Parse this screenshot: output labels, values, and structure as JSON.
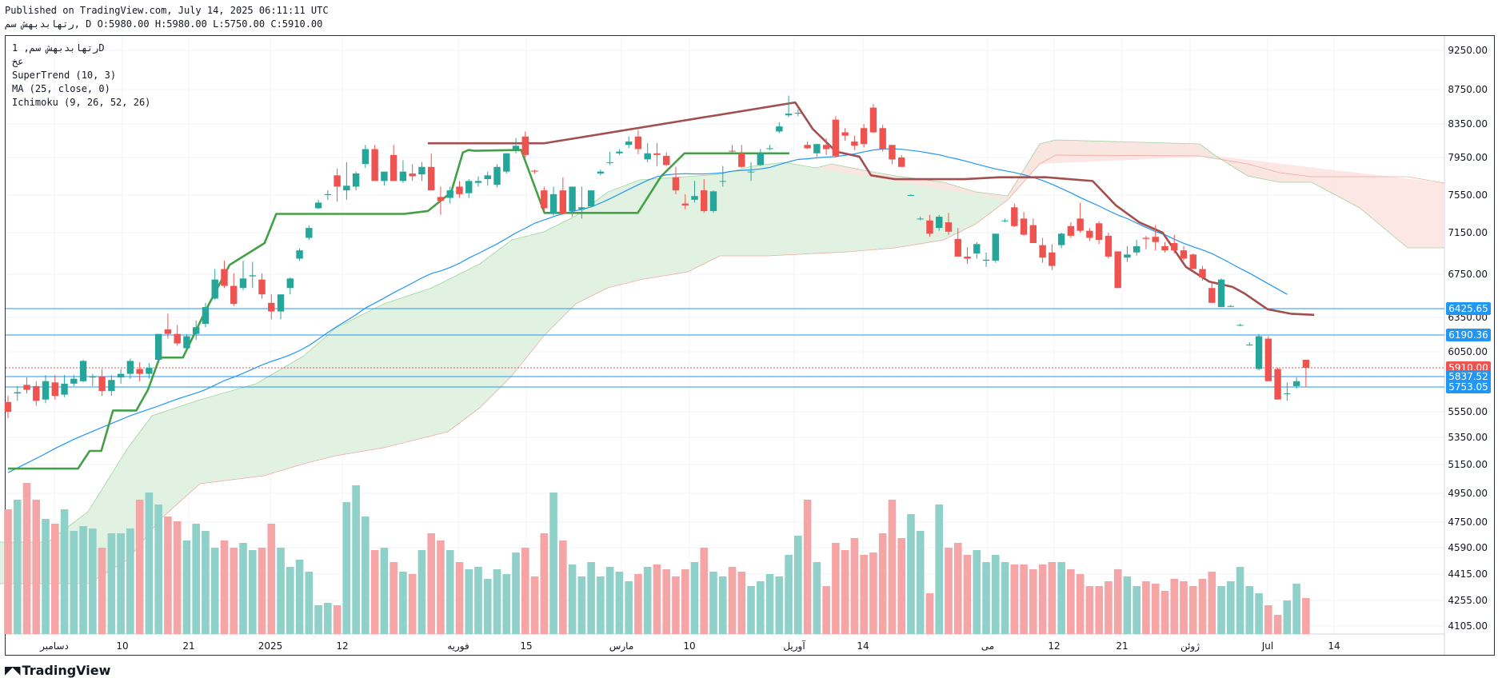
{
  "header": {
    "published": "Published on TradingView.com, July 14, 2025 06:11:11 UTC",
    "ohlc": "رتهابدبهش سم, D O:5980.00 H:5980.00 L:5750.00 C:5910.00"
  },
  "legend": {
    "symbol": "رتهابدبهش سم, 1D",
    "exchange": "عخ",
    "supertrend": "SuperTrend (10, 3)",
    "ma": "MA (25, close, 0)",
    "ichimoku": "Ichimoku (9, 26, 52, 26)"
  },
  "brand": {
    "name": "TradingView",
    "icon": "tradingview-logo-icon"
  },
  "colors": {
    "up": "#26a69a",
    "down": "#ef5350",
    "vol_up": "#8fd0c9",
    "vol_down": "#f5a5a5",
    "ma": "#2196f3",
    "st_up": "#43a047",
    "st_down": "#a14f4f",
    "cloud_green": "#e2f2e2",
    "cloud_red": "#fde4e1",
    "hline": "#2196f3"
  },
  "chart_data": {
    "type": "candlestick",
    "y_axis": {
      "ticks": [
        "9250.00",
        "8750.00",
        "8350.00",
        "7950.00",
        "7550.00",
        "7150.00",
        "6750.00",
        "6350.00",
        "6050.00",
        "5550.00",
        "5350.00",
        "5150.00",
        "4950.00",
        "4750.00",
        "4590.00",
        "4415.00",
        "4255.00",
        "4105.00"
      ]
    },
    "x_axis": {
      "labels": [
        "دسامبر",
        "10",
        "21",
        "2025",
        "12",
        "فوریه",
        "15",
        "مارس",
        "10",
        "آوریل",
        "14",
        "می",
        "12",
        "21",
        "ژوئن",
        "Jul",
        "14"
      ]
    },
    "price_lines": [
      {
        "label": "6425.65",
        "value": 6425.65,
        "style": "solid"
      },
      {
        "label": "6190.36",
        "value": 6190.36,
        "style": "solid"
      },
      {
        "label": "5910.00",
        "value": 5910.0,
        "style": "dotted",
        "current": true
      },
      {
        "label": "5837.52",
        "value": 5837.52,
        "style": "solid"
      },
      {
        "label": "5753.05",
        "value": 5753.05,
        "style": "solid"
      }
    ],
    "candles": [
      [
        5630,
        5680,
        5500,
        5550
      ],
      [
        5700,
        5760,
        5640,
        5710
      ],
      [
        5770,
        5830,
        5700,
        5730
      ],
      [
        5760,
        5800,
        5600,
        5640
      ],
      [
        5650,
        5850,
        5620,
        5800
      ],
      [
        5790,
        5850,
        5650,
        5680
      ],
      [
        5690,
        5850,
        5670,
        5780
      ],
      [
        5780,
        5850,
        5760,
        5820
      ],
      [
        5800,
        5980,
        5790,
        5970
      ],
      [
        5830,
        5860,
        5760,
        5840
      ],
      [
        5840,
        5900,
        5680,
        5720
      ],
      [
        5720,
        5850,
        5680,
        5810
      ],
      [
        5830,
        5900,
        5780,
        5860
      ],
      [
        5860,
        5990,
        5820,
        5970
      ],
      [
        5900,
        5960,
        5800,
        5860
      ],
      [
        5860,
        5950,
        5820,
        5910
      ],
      [
        5980,
        6200,
        5960,
        6200
      ],
      [
        6240,
        6380,
        6160,
        6200
      ],
      [
        6200,
        6280,
        6100,
        6120
      ],
      [
        6080,
        6200,
        6060,
        6180
      ],
      [
        6200,
        6320,
        6150,
        6260
      ],
      [
        6290,
        6480,
        6260,
        6440
      ],
      [
        6520,
        6800,
        6510,
        6700
      ],
      [
        6800,
        6880,
        6620,
        6640
      ],
      [
        6640,
        6760,
        6450,
        6470
      ],
      [
        6620,
        6880,
        6600,
        6710
      ],
      [
        6730,
        6870,
        6620,
        6740
      ],
      [
        6700,
        6760,
        6520,
        6560
      ],
      [
        6480,
        6560,
        6330,
        6400
      ],
      [
        6400,
        6560,
        6330,
        6560
      ],
      [
        6620,
        6720,
        6560,
        6710
      ],
      [
        6900,
        7000,
        6880,
        6980
      ],
      [
        7100,
        7230,
        7080,
        7200
      ],
      [
        7410,
        7500,
        7400,
        7470
      ],
      [
        7550,
        7600,
        7500,
        7560
      ],
      [
        7760,
        7830,
        7480,
        7640
      ],
      [
        7600,
        7900,
        7500,
        7650
      ],
      [
        7640,
        7800,
        7600,
        7780
      ],
      [
        7880,
        8100,
        7840,
        8050
      ],
      [
        8050,
        8100,
        7720,
        7700
      ],
      [
        7700,
        7800,
        7650,
        7800
      ],
      [
        7980,
        8100,
        7700,
        7700
      ],
      [
        7700,
        7920,
        7680,
        7800
      ],
      [
        7780,
        7880,
        7700,
        7750
      ],
      [
        7770,
        7900,
        7700,
        7850
      ],
      [
        7850,
        8000,
        7600,
        7600
      ],
      [
        7530,
        7640,
        7340,
        7490
      ],
      [
        7520,
        7640,
        7460,
        7600
      ],
      [
        7640,
        7700,
        7520,
        7560
      ],
      [
        7570,
        7720,
        7520,
        7700
      ],
      [
        7680,
        7750,
        7640,
        7700
      ],
      [
        7720,
        7800,
        7650,
        7760
      ],
      [
        7660,
        7880,
        7630,
        7850
      ],
      [
        7800,
        8000,
        7780,
        8000
      ],
      [
        8050,
        8180,
        8000,
        8090
      ],
      [
        8200,
        8260,
        7950,
        7980
      ],
      [
        7810,
        7820,
        7780,
        7800
      ],
      [
        7600,
        7640,
        7380,
        7410
      ],
      [
        7350,
        7640,
        7330,
        7560
      ],
      [
        7600,
        7740,
        7340,
        7350
      ],
      [
        7380,
        7640,
        7320,
        7640
      ],
      [
        7400,
        7640,
        7300,
        7420
      ],
      [
        7430,
        7600,
        7420,
        7600
      ],
      [
        7780,
        7820,
        7760,
        7800
      ],
      [
        7900,
        8020,
        7870,
        7900
      ],
      [
        8000,
        8050,
        7980,
        8020
      ],
      [
        8100,
        8200,
        8060,
        8140
      ],
      [
        8200,
        8280,
        7990,
        8050
      ],
      [
        7930,
        8120,
        7900,
        8000
      ],
      [
        8000,
        8120,
        7860,
        7980
      ],
      [
        7970,
        8010,
        7860,
        7870
      ],
      [
        7740,
        7850,
        7560,
        7600
      ],
      [
        7460,
        7560,
        7400,
        7440
      ],
      [
        7500,
        7700,
        7470,
        7540
      ],
      [
        7600,
        7720,
        7360,
        7380
      ],
      [
        7380,
        7600,
        7360,
        7590
      ],
      [
        7700,
        7860,
        7640,
        7700
      ],
      [
        8030,
        8100,
        7990,
        8020
      ],
      [
        8000,
        8100,
        7840,
        7850
      ],
      [
        7800,
        7900,
        7700,
        7800
      ],
      [
        7870,
        8050,
        7860,
        8000
      ],
      [
        8050,
        8100,
        8040,
        8060
      ],
      [
        8260,
        8370,
        8240,
        8320
      ],
      [
        8450,
        8680,
        8430,
        8470
      ],
      [
        8470,
        8520,
        8440,
        8480
      ],
      [
        8100,
        8140,
        8050,
        8060
      ],
      [
        8000,
        8110,
        7960,
        8110
      ],
      [
        8100,
        8180,
        7980,
        8050
      ],
      [
        8400,
        8440,
        7950,
        7970
      ],
      [
        8250,
        8300,
        8150,
        8210
      ],
      [
        8140,
        8210,
        8040,
        8090
      ],
      [
        8300,
        8350,
        8070,
        8110
      ],
      [
        8540,
        8580,
        8240,
        8250
      ],
      [
        8300,
        8340,
        8020,
        8050
      ],
      [
        8100,
        8100,
        7880,
        7930
      ],
      [
        7950,
        7980,
        7850,
        7850
      ],
      [
        7550,
        7560,
        7540,
        7550
      ],
      [
        7300,
        7320,
        7280,
        7300
      ],
      [
        7280,
        7340,
        7110,
        7140
      ],
      [
        7200,
        7340,
        7170,
        7320
      ],
      [
        7260,
        7360,
        7130,
        7160
      ],
      [
        7090,
        7200,
        6920,
        6920
      ],
      [
        6920,
        7010,
        6850,
        6900
      ],
      [
        6950,
        7060,
        6900,
        7040
      ],
      [
        6880,
        6960,
        6820,
        6890
      ],
      [
        6880,
        7140,
        6860,
        7140
      ],
      [
        7280,
        7300,
        7260,
        7280
      ],
      [
        7420,
        7460,
        7210,
        7220
      ],
      [
        7300,
        7370,
        7120,
        7130
      ],
      [
        7230,
        7300,
        7050,
        7050
      ],
      [
        7030,
        7100,
        6860,
        6910
      ],
      [
        6960,
        7040,
        6790,
        6830
      ],
      [
        7030,
        7150,
        7000,
        7140
      ],
      [
        7220,
        7260,
        7100,
        7120
      ],
      [
        7300,
        7470,
        7150,
        7170
      ],
      [
        7170,
        7200,
        7070,
        7100
      ],
      [
        7250,
        7270,
        7040,
        7080
      ],
      [
        7120,
        7150,
        6900,
        6920
      ],
      [
        6970,
        6970,
        6620,
        6620
      ],
      [
        6910,
        7020,
        6870,
        6940
      ],
      [
        6960,
        7080,
        6930,
        7020
      ],
      [
        7100,
        7120,
        6990,
        7090
      ],
      [
        7110,
        7230,
        6980,
        7060
      ],
      [
        7020,
        7060,
        6960,
        6980
      ],
      [
        7050,
        7130,
        6950,
        6980
      ],
      [
        6980,
        7020,
        6880,
        6900
      ],
      [
        6940,
        6950,
        6800,
        6800
      ],
      [
        6800,
        6830,
        6690,
        6720
      ],
      [
        6620,
        6670,
        6480,
        6480
      ],
      [
        6440,
        6710,
        6440,
        6700
      ],
      [
        6450,
        6460,
        6440,
        6450
      ],
      [
        6280,
        6290,
        6270,
        6280
      ],
      [
        6110,
        6130,
        6100,
        6110
      ],
      [
        5900,
        6200,
        5890,
        6180
      ],
      [
        6160,
        6180,
        5810,
        5800
      ],
      [
        5900,
        5910,
        5720,
        5650
      ],
      [
        5700,
        5790,
        5640,
        5700
      ],
      [
        5760,
        5830,
        5740,
        5800
      ],
      [
        5980,
        5980,
        5750,
        5910
      ]
    ],
    "volume": [
      52,
      56,
      63,
      56,
      48,
      46,
      52,
      43,
      45,
      44,
      36,
      42,
      42,
      44,
      56,
      59,
      54,
      49,
      47,
      39,
      46,
      43,
      36,
      39,
      36,
      38,
      35,
      36,
      46,
      36,
      28,
      31,
      26,
      12,
      13,
      12,
      55,
      62,
      49,
      35,
      36,
      30,
      26,
      25,
      35,
      42,
      39,
      35,
      30,
      27,
      28,
      23,
      27,
      25,
      34,
      36,
      24,
      42,
      59,
      39,
      29,
      24,
      30,
      24,
      28,
      26,
      22,
      25,
      28,
      29,
      27,
      24,
      27,
      30,
      36,
      26,
      24,
      28,
      26,
      20,
      22,
      25,
      24,
      33,
      41,
      56,
      30,
      20,
      38,
      35,
      40,
      33,
      34,
      42,
      56,
      40,
      50,
      43,
      17,
      54,
      36,
      38,
      33,
      35,
      30,
      33,
      30,
      29,
      29,
      27,
      29,
      30,
      30,
      27,
      25,
      20,
      20,
      22,
      27,
      24,
      20,
      22,
      21,
      18,
      23,
      22,
      20,
      23,
      26,
      20,
      22,
      28,
      20,
      17,
      12,
      8,
      14,
      21,
      15,
      50,
      40,
      25,
      28
    ],
    "ma": [
      5090,
      5125,
      5160,
      5195,
      5230,
      5268,
      5302,
      5335,
      5366,
      5397,
      5428,
      5458,
      5489,
      5519,
      5545,
      5571,
      5597,
      5626,
      5654,
      5679,
      5703,
      5731,
      5768,
      5805,
      5833,
      5864,
      5899,
      5935,
      5966,
      5993,
      6023,
      6060,
      6103,
      6156,
      6213,
      6268,
      6319,
      6371,
      6431,
      6478,
      6525,
      6576,
      6621,
      6667,
      6715,
      6756,
      6782,
      6815,
      6856,
      6906,
      6950,
      6996,
      7042,
      7094,
      7148,
      7197,
      7251,
      7286,
      7321,
      7352,
      7376,
      7398,
      7423,
      7465,
      7511,
      7560,
      7611,
      7659,
      7707,
      7746,
      7765,
      7774,
      7778,
      7775,
      7775,
      7780,
      7787,
      7805,
      7813,
      7818,
      7828,
      7844,
      7875,
      7904,
      7930,
      7936,
      7947,
      7955,
      7961,
      7977,
      7993,
      8017,
      8039,
      8051,
      8054,
      8048,
      8035,
      8021,
      8001,
      7983,
      7954,
      7932,
      7907,
      7879,
      7854,
      7828,
      7809,
      7790,
      7767,
      7738,
      7705,
      7665,
      7621,
      7574,
      7524,
      7478,
      7434,
      7384,
      7338,
      7300,
      7252,
      7206,
      7161,
      7130,
      7087,
      7048,
      7015,
      6984,
      6949,
      6903,
      6855,
      6806,
      6760,
      6710,
      6660,
      6610,
      6560
    ],
    "supertrend": [
      {
        "trend": "up",
        "points": [
          [
            0,
            5120
          ],
          [
            12,
            5120
          ],
          [
            14,
            5250
          ],
          [
            16,
            5250
          ],
          [
            18,
            5560
          ],
          [
            22,
            5560
          ],
          [
            24,
            5730
          ],
          [
            26,
            6000
          ],
          [
            30,
            6000
          ],
          [
            34,
            6420
          ],
          [
            38,
            6840
          ],
          [
            42,
            6980
          ],
          [
            44,
            7050
          ],
          [
            46,
            7350
          ],
          [
            66,
            7350
          ],
          [
            68,
            7350
          ],
          [
            72,
            7380
          ],
          [
            76,
            7580
          ],
          [
            78,
            8010
          ],
          [
            79,
            8040
          ],
          [
            80,
            8030
          ],
          [
            88,
            8040
          ],
          [
            92,
            7360
          ],
          [
            104,
            7360
          ],
          [
            108,
            7360
          ],
          [
            112,
            7750
          ],
          [
            116,
            8000
          ],
          [
            130,
            8000
          ],
          [
            134,
            8000
          ]
        ]
      },
      {
        "trend": "down",
        "points": [
          [
            72,
            8120
          ],
          [
            80,
            8120
          ],
          [
            86,
            8120
          ],
          [
            90,
            8120
          ],
          [
            92,
            8120
          ],
          [
            135,
            8600
          ],
          [
            138,
            8290
          ],
          [
            142,
            8020
          ],
          [
            146,
            7960
          ],
          [
            148,
            7760
          ],
          [
            152,
            7720
          ],
          [
            164,
            7720
          ],
          [
            170,
            7740
          ],
          [
            178,
            7740
          ],
          [
            182,
            7720
          ],
          [
            186,
            7700
          ],
          [
            190,
            7440
          ],
          [
            194,
            7260
          ],
          [
            198,
            7150
          ],
          [
            202,
            6820
          ],
          [
            206,
            6680
          ],
          [
            210,
            6630
          ],
          [
            212,
            6570
          ],
          [
            216,
            6420
          ],
          [
            220,
            6380
          ],
          [
            224,
            6370
          ]
        ]
      }
    ]
  }
}
